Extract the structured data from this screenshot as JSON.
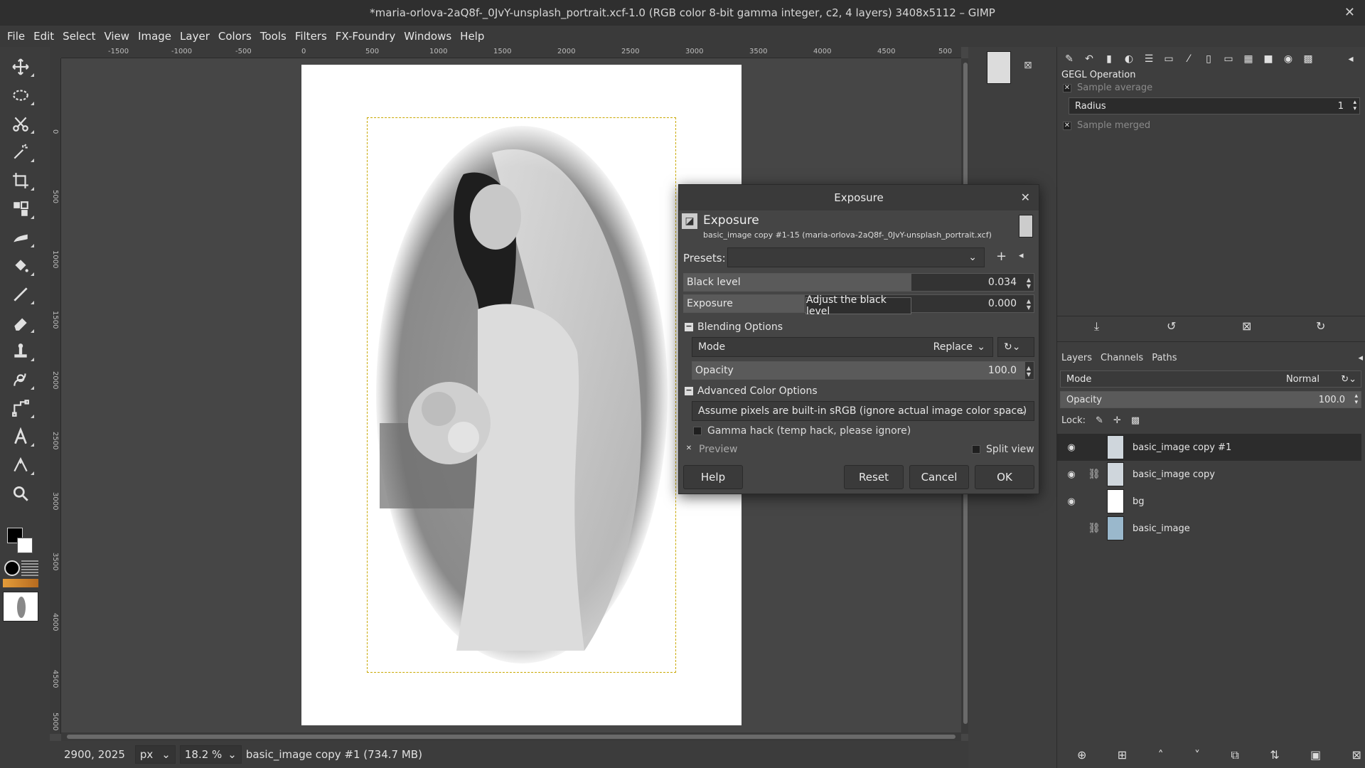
{
  "window": {
    "title": "*maria-orlova-2aQ8f-_0JvY-unsplash_portrait.xcf-1.0 (RGB color 8-bit gamma integer, c2, 4 layers) 3408x5112 – GIMP",
    "close": "✕"
  },
  "menu": [
    "File",
    "Edit",
    "Select",
    "View",
    "Image",
    "Layer",
    "Colors",
    "Tools",
    "Filters",
    "FX-Foundry",
    "Windows",
    "Help"
  ],
  "tools": [
    "move-tool-icon",
    "ellipse-select-icon",
    "scissors-select-icon",
    "fuzzy-select-icon",
    "crop-icon",
    "unified-transform-icon",
    "warp-icon",
    "bucket-fill-icon",
    "paintbrush-icon",
    "eraser-icon",
    "clone-icon",
    "smudge-icon",
    "paths-icon",
    "text-tool-icon",
    "measure-icon",
    "zoom-icon"
  ],
  "ruler": {
    "top_ticks": [
      "-1500",
      "-1000",
      "-500",
      "0",
      "500",
      "1000",
      "1500",
      "2000",
      "2500",
      "3000",
      "3500",
      "4000",
      "4500",
      "500"
    ],
    "left_ticks": [
      "0",
      "500",
      "1000",
      "1500",
      "2000",
      "2500",
      "3000",
      "3500",
      "4000",
      "4500",
      "5000"
    ]
  },
  "status": {
    "coords": "2900, 2025",
    "unit": "px",
    "zoom": "18.2 %",
    "info": "basic_image copy #1 (734.7 MB)"
  },
  "gegl": {
    "title": "GEGL Operation",
    "sample_average": "Sample average",
    "radius_label": "Radius",
    "radius_value": "1",
    "sample_merged": "Sample merged"
  },
  "layers_panel": {
    "tabs": [
      "Layers",
      "Channels",
      "Paths"
    ],
    "mode_label": "Mode",
    "mode_value": "Normal",
    "opacity_label": "Opacity",
    "opacity_value": "100.0",
    "lock_label": "Lock:",
    "layers": [
      {
        "name": "basic_image copy #1",
        "visible": true,
        "linked": false
      },
      {
        "name": "basic_image copy",
        "visible": true,
        "linked": true
      },
      {
        "name": "bg",
        "visible": true,
        "linked": false
      },
      {
        "name": "basic_image",
        "visible": false,
        "linked": true
      }
    ]
  },
  "dialog": {
    "title": "Exposure",
    "heading": "Exposure",
    "subheading": "basic_image copy #1-15 (maria-orlova-2aQ8f-_0JvY-unsplash_portrait.xcf)",
    "presets_label": "Presets:",
    "black_level_label": "Black level",
    "black_level_value": "0.034",
    "exposure_label": "Exposure",
    "exposure_value": "0.000",
    "tooltip": "Adjust the black level",
    "blending_header": "Blending Options",
    "mode_label": "Mode",
    "mode_value": "Replace",
    "opacity_label": "Opacity",
    "opacity_value": "100.0",
    "advanced_header": "Advanced Color Options",
    "color_space_value": "Assume pixels are built-in sRGB (ignore actual image color space)",
    "gamma_hack": "Gamma hack (temp hack, please ignore)",
    "preview_label": "Preview",
    "split_view_label": "Split view",
    "buttons": {
      "help": "Help",
      "reset": "Reset",
      "cancel": "Cancel",
      "ok": "OK"
    }
  }
}
